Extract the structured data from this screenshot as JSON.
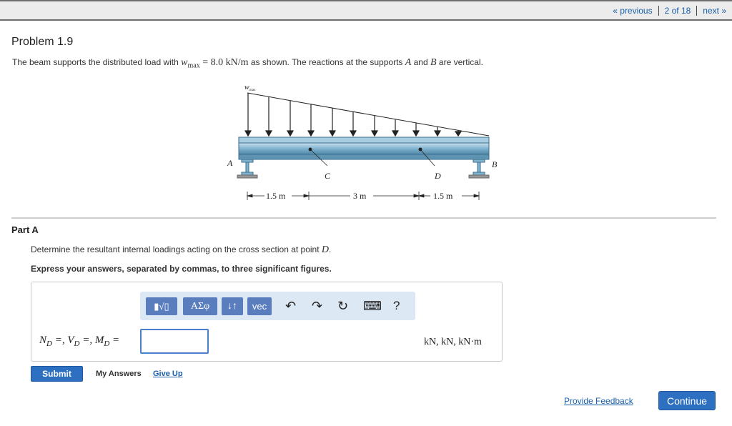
{
  "nav": {
    "previous": "« previous",
    "position": "2 of 18",
    "next": "next »"
  },
  "problem": {
    "title": "Problem 1.9",
    "statement_pre": "The beam supports the distributed load with ",
    "w_symbol": "w",
    "w_sub": "max",
    "w_value": " = 8.0 kN/m",
    "statement_mid": " as shown. The reactions at the supports ",
    "A": "A",
    "and": " and ",
    "B": "B",
    "statement_post": " are vertical."
  },
  "figure": {
    "wmax_label": "w",
    "wmax_sub": "max",
    "label_A": "A",
    "label_B": "B",
    "label_C": "C",
    "label_D": "D",
    "dim1": "1.5 m",
    "dim2": "3 m",
    "dim3": "1.5 m"
  },
  "partA": {
    "label": "Part A",
    "question_pre": "Determine the resultant internal loadings acting on the cross section at point ",
    "question_point": "D",
    "question_post": ".",
    "instruction": "Express your answers, separated by commas, to three significant figures.",
    "lhs": "N_D =, V_D =, M_D =",
    "input_value": "",
    "units": "kN, kN, kN·m"
  },
  "toolbar": {
    "templates": "▮√▯",
    "greek": "ΑΣφ",
    "sort": "↓↑",
    "vec": "vec",
    "undo": "↶",
    "redo": "↷",
    "reset": "↻",
    "keyboard": "⌨",
    "help": "?"
  },
  "actions": {
    "submit": "Submit",
    "my_answers": "My Answers",
    "give_up": "Give Up",
    "provide_feedback": "Provide Feedback",
    "continue": "Continue"
  },
  "colors": {
    "accent": "#2d6fc1",
    "link": "#1a5fa8",
    "beam": "#7fb3cf",
    "toolbar_bg": "#dde8f5",
    "button": "#5a7dbd"
  }
}
